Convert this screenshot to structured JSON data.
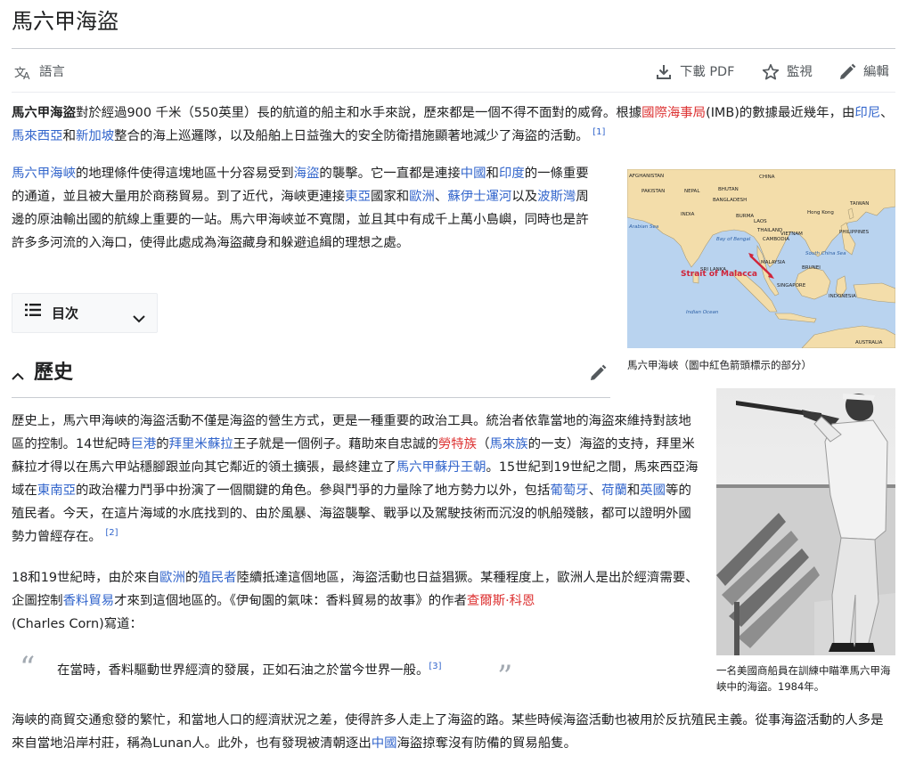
{
  "page": {
    "title": "馬六甲海盜"
  },
  "toolbar": {
    "language_label": "語言",
    "pdf_label": "下載 PDF",
    "watch_label": "監視",
    "edit_label": "編輯"
  },
  "lead": {
    "bold_title": "馬六甲海盜",
    "t1": "對於經過900 千米（550英里）長的航道的船主和水手來說，歷來都是一個不得不面對的威脅。根據",
    "link_imb": "國際海事局",
    "t2": "(IMB)的數據最近幾年，由",
    "link_indonesia": "印尼",
    "sep1": "、",
    "link_malaysia": "馬來西亞",
    "and1": "和",
    "link_singapore": "新加坡",
    "t3": "整合的海上巡邏隊，以及船舶上日益強大的安全防衛措施顯著地減少了海盜的活動。",
    "ref1": "[1]"
  },
  "strait_para": {
    "link_strait": "馬六甲海峽",
    "t1": "的地理條件使得這塊地區十分容易受到",
    "link_pirate": "海盜",
    "t2": "的襲擊。它一直都是連接",
    "link_china": "中國",
    "and1": "和",
    "link_india": "印度",
    "t3": "的一條重要的通道，並且被大量用於商務貿易。到了近代，海峽更連接",
    "link_eastasia": "東亞",
    "t4": "國家和",
    "link_europe": "歐洲",
    "sep1": "、",
    "link_suez": "蘇伊士運河",
    "t5": "以及",
    "link_gulf": "波斯灣",
    "t6": "周邊的原油輸出國的航線上重要的一站。馬六甲海峽並不寬闊，並且其中有成千上萬小島嶼，同時也是許許多多河流的入海口，使得此處成為海盜藏身和躲避追緝的理想之處。"
  },
  "toc": {
    "label": "目次"
  },
  "map_figure": {
    "caption": "馬六甲海峽（圖中紅色箭頭標示的部分）",
    "labels": {
      "afghanistan": "AFGHANISTAN",
      "china": "CHINA",
      "pakistan": "PAKISTAN",
      "nepal": "NEPAL",
      "bhutan": "BHUTAN",
      "bangladesh": "BANGLADESH",
      "india": "INDIA",
      "burma": "BURMA",
      "laos": "LAOS",
      "thailand": "THAILAND",
      "vietnam": "VIETNAM",
      "cambodia": "CAMBODIA",
      "hongkong": "Hong Kong",
      "taiwan": "TAIWAN",
      "philippines": "PHILIPPINES",
      "srilanka": "SRI LANKA",
      "malaysia": "MALAYSIA",
      "brunei": "BRUNEI",
      "singapore": "SINGAPORE",
      "indonesia": "INDONESIA",
      "australia": "AUSTRALIA",
      "arabian_sea": "Arabian Sea",
      "bay_of_bengal": "Bay of Bengal",
      "south_china_sea": "South China Sea",
      "indian_ocean": "Indian Ocean",
      "strait": "Strait of Malacca"
    }
  },
  "history": {
    "title": "歷史",
    "p1": {
      "t1": "歷史上，馬六甲海峽的海盜活動不僅是海盜的營生方式，更是一種重要的政治工具。統治者依靠當地的海盜來維持對該地區的控制。14世紀時",
      "link_palembang": "巨港",
      "t2": "的",
      "link_parameswara": "拜里米蘇拉",
      "t3": "王子就是一個例子。藉助來自忠誠的",
      "link_orang_laut": "勞特族",
      "t4": "（",
      "link_malay": "馬來族",
      "t5": "的一支）海盜的支持，拜里米蘇拉才得以在馬六甲站穩腳跟並向其它鄰近的領土擴張，最終建立了",
      "link_sultanate": "馬六甲蘇丹王朝",
      "t6": "。15世紀到19世紀之間，馬來西亞海域在",
      "link_se_asia": "東南亞",
      "t7": "的政治權力鬥爭中扮演了一個關鍵的角色。參與鬥爭的力量除了地方勢力以外，包括",
      "link_portugal": "葡萄牙",
      "sep1": "、",
      "link_netherlands": "荷蘭",
      "and1": "和",
      "link_britain": "英國",
      "t8": "等的殖民者。今天，在這片海域的水底找到的、由於風暴、海盜襲擊、戰爭以及駕駛技術而沉沒的帆船殘骸，都可以證明外國勢力曾經存在。",
      "ref2": "[2]"
    },
    "p2": {
      "t1": "18和19世紀時，由於來自",
      "link_europe": "歐洲",
      "t2": "的",
      "link_colonist": "殖民者",
      "t3": "陸續抵達這個地區，海盜活動也日益猖獗。某種程度上，歐洲人是出於經濟需要、企圖控制",
      "link_spice": "香料貿易",
      "t4": "才來到這個地區的。《伊甸園的氣味：香料貿易的故事》的作者",
      "link_corn": "查爾斯·科恩",
      "t5": "(Charles Corn)寫道："
    },
    "quote": {
      "open": "“",
      "text": "在當時，香料驅動世界經濟的發展，正如石油之於當今世界一般。",
      "ref3": "[3]",
      "close": "”"
    },
    "p3": {
      "t1": "海峽的商貿交通愈發的繁忙，和當地人口的經濟狀況之差，使得許多人走上了海盜的路。某些時候海盜活動也被用於反抗殖民主義。從事海盜活動的人多是來自當地沿岸村莊，稱為Lunan人。此外，也有發現被清朝逐出",
      "link_china": "中國",
      "t2": "海盜掠奪沒有防備的貿易船隻。"
    }
  },
  "sailor_figure": {
    "caption": "一名美國商船員在訓練中瞄準馬六甲海峽中的海盜。1984年。"
  },
  "colors": {
    "link": "#3366cc",
    "redlink": "#dd3333",
    "text": "#202122",
    "ocean": "#b9d3ef",
    "land": "#f3ddaa",
    "arrow": "#d0243a"
  }
}
